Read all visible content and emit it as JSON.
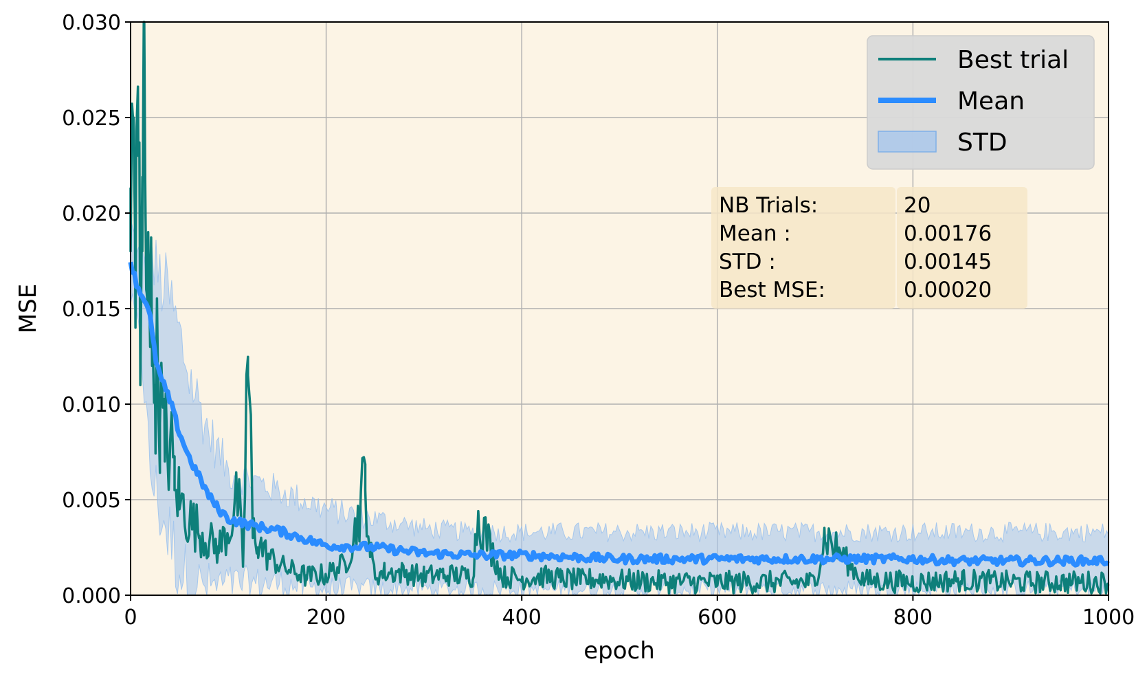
{
  "chart_data": {
    "type": "line",
    "xlabel": "epoch",
    "ylabel": "MSE",
    "xlim": [
      0,
      1000
    ],
    "ylim": [
      0,
      0.03
    ],
    "xticks": [
      0,
      200,
      400,
      600,
      800,
      1000
    ],
    "xtick_labels": [
      "0",
      "200",
      "400",
      "600",
      "800",
      "1000"
    ],
    "yticks": [
      0,
      0.005,
      0.01,
      0.015,
      0.02,
      0.025,
      0.03
    ],
    "ytick_labels": [
      "0.000",
      "0.005",
      "0.010",
      "0.015",
      "0.020",
      "0.025",
      "0.030"
    ],
    "grid": true,
    "background_color": "#fcf4e5",
    "legend": {
      "position": "top-right",
      "entries": [
        {
          "label": "Best trial",
          "kind": "line",
          "color": "#0e7f7a"
        },
        {
          "label": "Mean",
          "kind": "line",
          "color": "#2b8cff"
        },
        {
          "label": "STD",
          "kind": "band",
          "color": "#a7c7ec"
        }
      ]
    },
    "stats_box": {
      "rows": [
        {
          "label": "NB Trials:",
          "value": "20"
        },
        {
          "label": "Mean :",
          "value": "0.00176"
        },
        {
          "label": "STD :",
          "value": "0.00145"
        },
        {
          "label": "Best MSE:",
          "value": "0.00020"
        }
      ]
    },
    "series": [
      {
        "name": "Best trial",
        "color": "#0e7f7a",
        "x": [
          0,
          3,
          5,
          8,
          10,
          12,
          14,
          16,
          18,
          20,
          22,
          25,
          30,
          35,
          40,
          45,
          50,
          55,
          60,
          70,
          80,
          90,
          100,
          110,
          115,
          120,
          125,
          130,
          140,
          150,
          160,
          170,
          180,
          200,
          220,
          230,
          240,
          245,
          250,
          260,
          280,
          300,
          320,
          350,
          355,
          380,
          400,
          420,
          440,
          460,
          480,
          500,
          550,
          600,
          650,
          700,
          710,
          750,
          800,
          850,
          900,
          950,
          1000
        ],
        "y": [
          0.018,
          0.025,
          0.014,
          0.023,
          0.011,
          0.018,
          0.031,
          0.016,
          0.019,
          0.013,
          0.012,
          0.011,
          0.009,
          0.007,
          0.007,
          0.0055,
          0.0045,
          0.004,
          0.0035,
          0.003,
          0.0025,
          0.0022,
          0.003,
          0.0045,
          0.0015,
          0.0115,
          0.003,
          0.0025,
          0.0018,
          0.0015,
          0.0012,
          0.001,
          0.0008,
          0.0009,
          0.0015,
          0.003,
          0.0055,
          0.002,
          0.0009,
          0.001,
          0.001,
          0.0008,
          0.0009,
          0.0008,
          0.0038,
          0.0008,
          0.0007,
          0.0008,
          0.0007,
          0.0006,
          0.0007,
          0.0006,
          0.0005,
          0.0005,
          0.0005,
          0.0005,
          0.0028,
          0.0006,
          0.0005,
          0.0006,
          0.0005,
          0.0005,
          0.0005
        ]
      },
      {
        "name": "Mean",
        "color": "#2b8cff",
        "x": [
          0,
          5,
          10,
          15,
          20,
          25,
          30,
          40,
          50,
          60,
          70,
          80,
          90,
          100,
          120,
          150,
          200,
          250,
          300,
          350,
          400,
          450,
          500,
          550,
          600,
          650,
          700,
          750,
          800,
          850,
          900,
          950,
          1000
        ],
        "y": [
          0.0175,
          0.0165,
          0.0158,
          0.0155,
          0.0145,
          0.0125,
          0.0115,
          0.0102,
          0.0085,
          0.0072,
          0.0062,
          0.0052,
          0.0045,
          0.004,
          0.0037,
          0.0034,
          0.0026,
          0.0025,
          0.0022,
          0.0021,
          0.0021,
          0.002,
          0.0019,
          0.0019,
          0.0019,
          0.0019,
          0.0019,
          0.0019,
          0.0019,
          0.0018,
          0.0018,
          0.0018,
          0.0018
        ]
      },
      {
        "name": "STD",
        "color": "#a7c7ec",
        "x": [
          0,
          10,
          20,
          30,
          40,
          50,
          60,
          80,
          100,
          150,
          200,
          250,
          300,
          350,
          400,
          500,
          600,
          700,
          800,
          900,
          1000
        ],
        "lower": [
          0.0155,
          0.0135,
          0.0065,
          0.0045,
          0.003,
          0.0015,
          0.0005,
          0.0004,
          0.0006,
          0.0006,
          0.0003,
          0.0003,
          0.0003,
          0.0003,
          0.0003,
          0.0003,
          0.0003,
          0.0003,
          0.0003,
          0.0003,
          0.0003
        ],
        "upper": [
          0.0195,
          0.0175,
          0.0175,
          0.0165,
          0.0155,
          0.0135,
          0.0115,
          0.0085,
          0.0065,
          0.0055,
          0.0045,
          0.004,
          0.0035,
          0.0033,
          0.0033,
          0.0033,
          0.0033,
          0.0033,
          0.0033,
          0.0033,
          0.0033
        ]
      }
    ]
  }
}
